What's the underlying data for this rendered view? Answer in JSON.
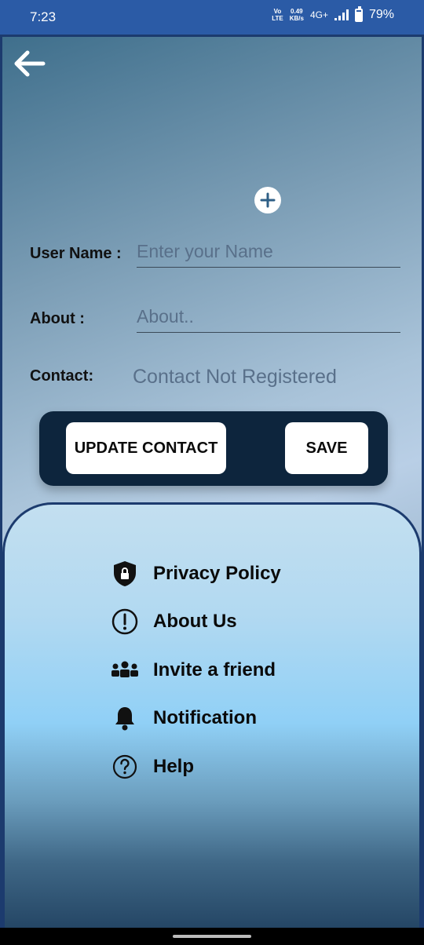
{
  "status_bar": {
    "time": "7:23",
    "volte_top": "Vo",
    "volte_bottom": "LTE",
    "speed_value": "0.49",
    "speed_unit": "KB/s",
    "network": "4G+",
    "battery": "79%"
  },
  "profile": {
    "username_label": "User Name :",
    "username_placeholder": "Enter your Name",
    "about_label": "About :",
    "about_placeholder": "About..",
    "contact_label": "Contact:",
    "contact_value": "Contact Not Registered"
  },
  "actions": {
    "update_label": "UPDATE CONTACT",
    "save_label": "SAVE"
  },
  "menu": {
    "items": [
      {
        "label": "Privacy Policy",
        "icon": "shield-lock-icon"
      },
      {
        "label": "About Us",
        "icon": "info-exclamation-icon"
      },
      {
        "label": "Invite a friend",
        "icon": "group-icon"
      },
      {
        "label": "Notification",
        "icon": "bell-icon"
      },
      {
        "label": "Help",
        "icon": "help-icon"
      }
    ]
  },
  "colors": {
    "status_bar": "#2b5ba6",
    "action_bar": "#0d253d",
    "border": "#1c3b6e"
  }
}
